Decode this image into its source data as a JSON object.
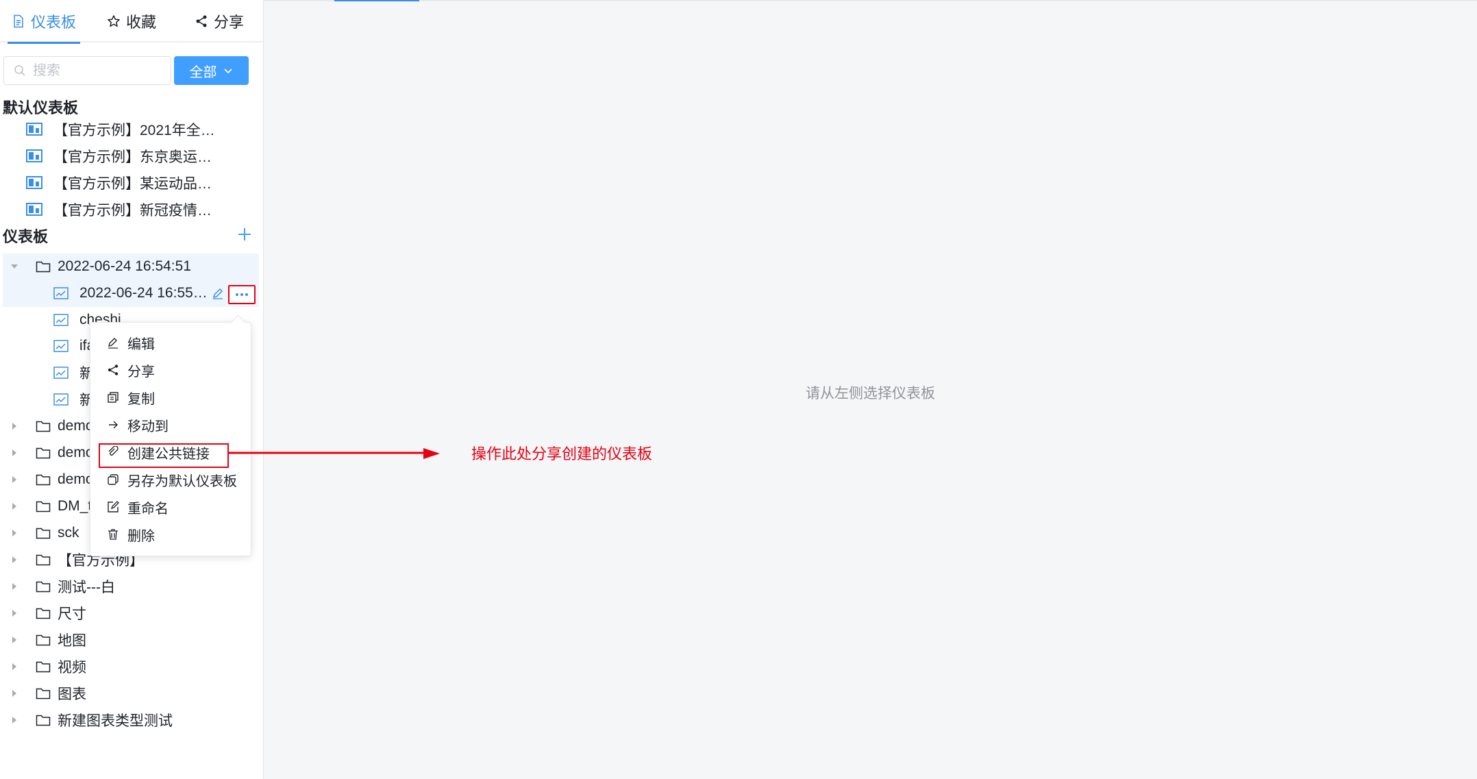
{
  "tabs": [
    {
      "label": "仪表板",
      "icon": "document-icon",
      "active": true
    },
    {
      "label": "收藏",
      "icon": "star-icon",
      "active": false
    },
    {
      "label": "分享",
      "icon": "share-icon",
      "active": false
    }
  ],
  "search": {
    "placeholder": "搜索",
    "value": ""
  },
  "filter": {
    "label": "全部"
  },
  "default_section": {
    "title": "默认仪表板",
    "items": [
      "【官方示例】2021年全…",
      "【官方示例】东京奥运…",
      "【官方示例】某运动品…",
      "【官方示例】新冠疫情…"
    ]
  },
  "dashboard_section": {
    "title": "仪表板",
    "expanded_folder": {
      "name": "2022-06-24 16:54:51",
      "children": [
        "2022-06-24 16:55…",
        "cheshi",
        "ifa",
        "新",
        "新"
      ]
    },
    "folders": [
      "demo",
      "demo",
      "demo",
      "DM_t",
      "sck",
      "【官方示例】",
      "测试---白",
      "尺寸",
      "地图",
      "视频",
      "图表",
      "新建图表类型测试"
    ]
  },
  "context_menu": [
    {
      "label": "编辑",
      "icon": "edit-icon"
    },
    {
      "label": "分享",
      "icon": "share-icon"
    },
    {
      "label": "复制",
      "icon": "copy-icon"
    },
    {
      "label": "移动到",
      "icon": "arrow-right-icon"
    },
    {
      "label": "创建公共链接",
      "icon": "link-icon"
    },
    {
      "label": "另存为默认仪表板",
      "icon": "save-default-icon"
    },
    {
      "label": "重命名",
      "icon": "rename-icon"
    },
    {
      "label": "删除",
      "icon": "trash-icon"
    }
  ],
  "main": {
    "empty_hint": "请从左侧选择仪表板",
    "annotation": "操作此处分享创建的仪表板"
  },
  "colors": {
    "accent": "#409eff",
    "annotation_red": "#e60012",
    "text": "#1f2329",
    "muted": "#909399"
  }
}
